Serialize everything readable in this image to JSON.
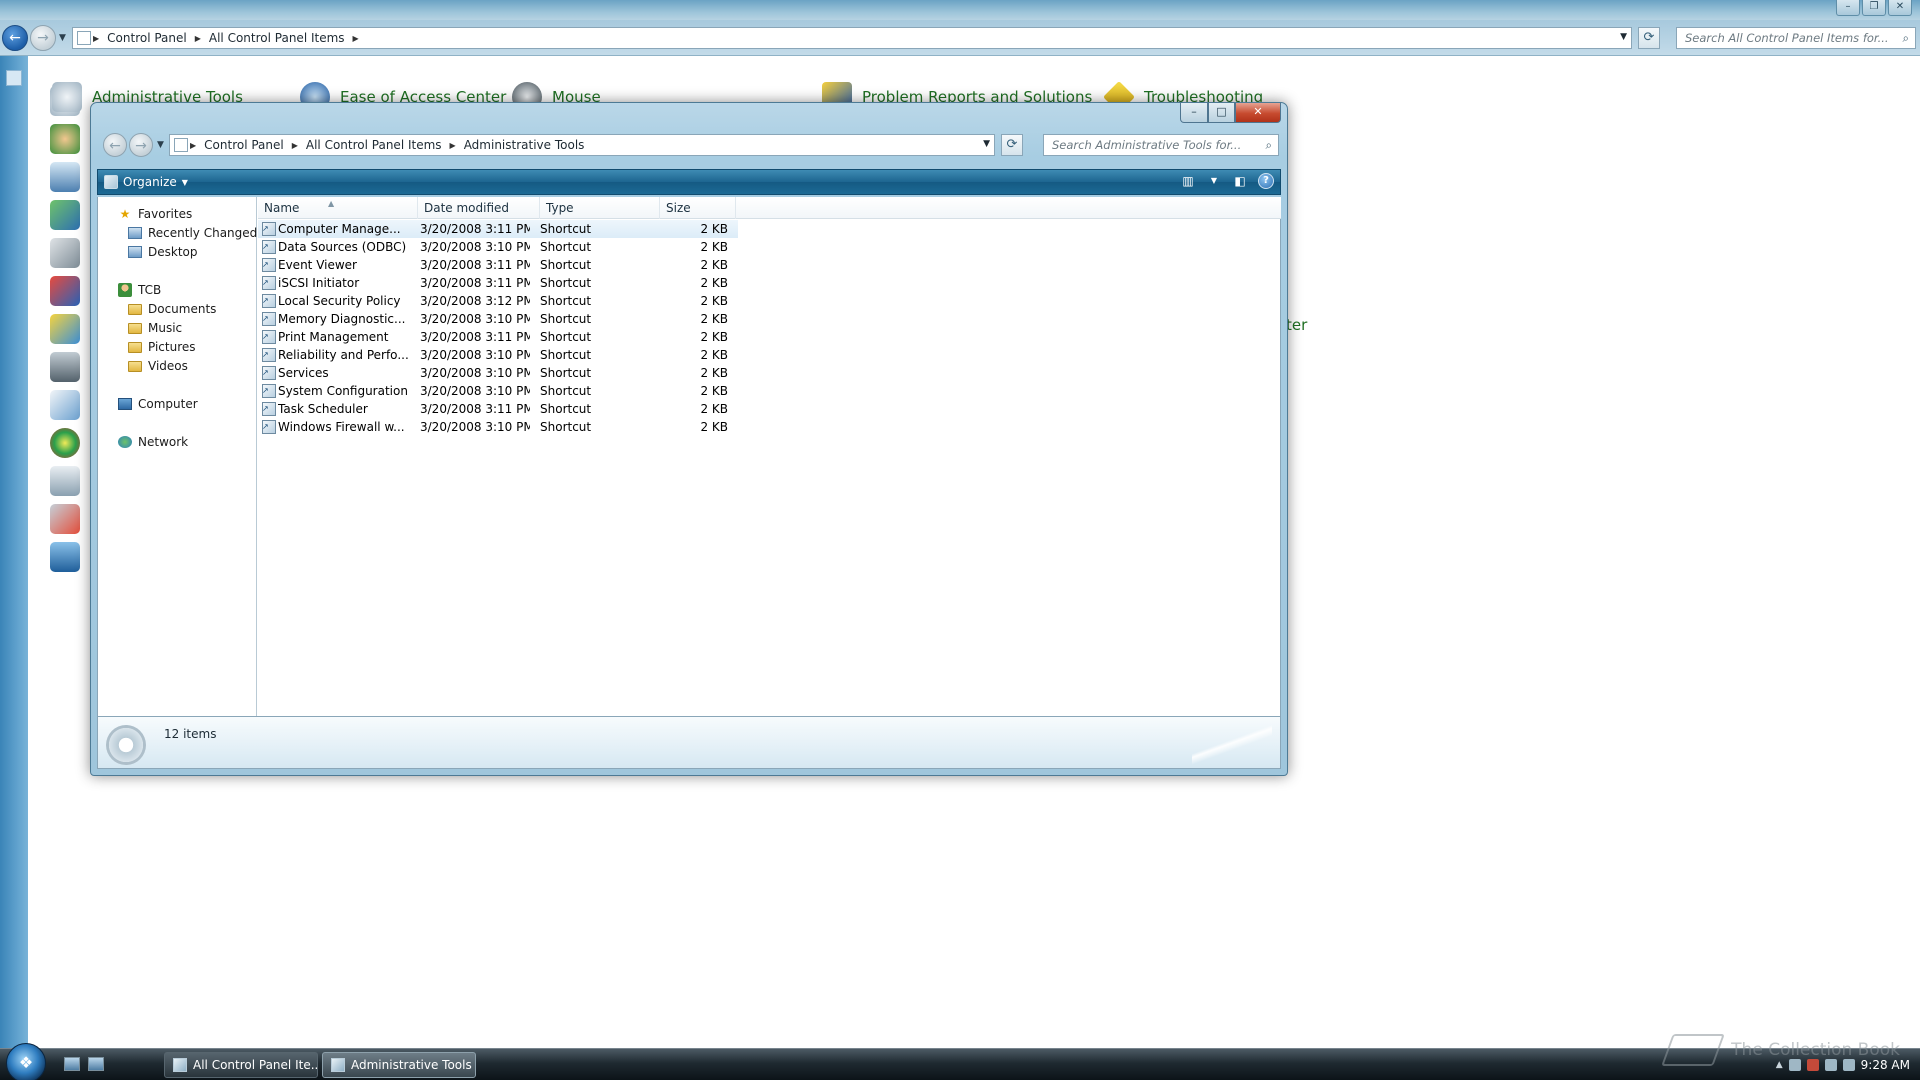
{
  "background_window": {
    "breadcrumb": [
      "Control Panel",
      "All Control Panel Items"
    ],
    "search_placeholder": "Search All Control Panel Items for...",
    "items": [
      {
        "label": "Administrative Tools",
        "icon": "admin-tools-icon"
      },
      {
        "label": "Ease of Access Center",
        "icon": "ease-of-access-icon"
      },
      {
        "label": "Mouse",
        "icon": "mouse-icon"
      },
      {
        "label": "Problem Reports and Solutions",
        "icon": "problem-reports-icon"
      },
      {
        "label": "Troubleshooting",
        "icon": "troubleshooting-icon"
      }
    ],
    "partial_label": "ter"
  },
  "window": {
    "breadcrumb": [
      "Control Panel",
      "All Control Panel Items",
      "Administrative Tools"
    ],
    "search_placeholder": "Search Administrative Tools for...",
    "toolbar": {
      "organize_label": "Organize"
    },
    "nav": {
      "favorites": {
        "label": "Favorites",
        "items": [
          "Recently Changed",
          "Desktop"
        ]
      },
      "user": {
        "label": "TCB",
        "items": [
          "Documents",
          "Music",
          "Pictures",
          "Videos"
        ]
      },
      "computer": "Computer",
      "network": "Network"
    },
    "columns": {
      "name": "Name",
      "date": "Date modified",
      "type": "Type",
      "size": "Size"
    },
    "rows": [
      {
        "name": "Computer Manage...",
        "date": "3/20/2008 3:11 PM",
        "type": "Shortcut",
        "size": "2 KB"
      },
      {
        "name": "Data Sources (ODBC)",
        "date": "3/20/2008 3:10 PM",
        "type": "Shortcut",
        "size": "2 KB"
      },
      {
        "name": "Event Viewer",
        "date": "3/20/2008 3:11 PM",
        "type": "Shortcut",
        "size": "2 KB"
      },
      {
        "name": "iSCSI Initiator",
        "date": "3/20/2008 3:11 PM",
        "type": "Shortcut",
        "size": "2 KB"
      },
      {
        "name": "Local Security Policy",
        "date": "3/20/2008 3:12 PM",
        "type": "Shortcut",
        "size": "2 KB"
      },
      {
        "name": "Memory Diagnostic...",
        "date": "3/20/2008 3:10 PM",
        "type": "Shortcut",
        "size": "2 KB"
      },
      {
        "name": "Print Management",
        "date": "3/20/2008 3:11 PM",
        "type": "Shortcut",
        "size": "2 KB"
      },
      {
        "name": "Reliability and Perfo...",
        "date": "3/20/2008 3:10 PM",
        "type": "Shortcut",
        "size": "2 KB"
      },
      {
        "name": "Services",
        "date": "3/20/2008 3:10 PM",
        "type": "Shortcut",
        "size": "2 KB"
      },
      {
        "name": "System Configuration",
        "date": "3/20/2008 3:10 PM",
        "type": "Shortcut",
        "size": "2 KB"
      },
      {
        "name": "Task Scheduler",
        "date": "3/20/2008 3:11 PM",
        "type": "Shortcut",
        "size": "2 KB"
      },
      {
        "name": "Windows Firewall w...",
        "date": "3/20/2008 3:10 PM",
        "type": "Shortcut",
        "size": "2 KB"
      }
    ],
    "status": "12 items"
  },
  "taskbar": {
    "buttons": [
      "All Control Panel Ite...",
      "Administrative Tools"
    ],
    "clock": "9:28 AM"
  },
  "watermark": "The Collection Book"
}
